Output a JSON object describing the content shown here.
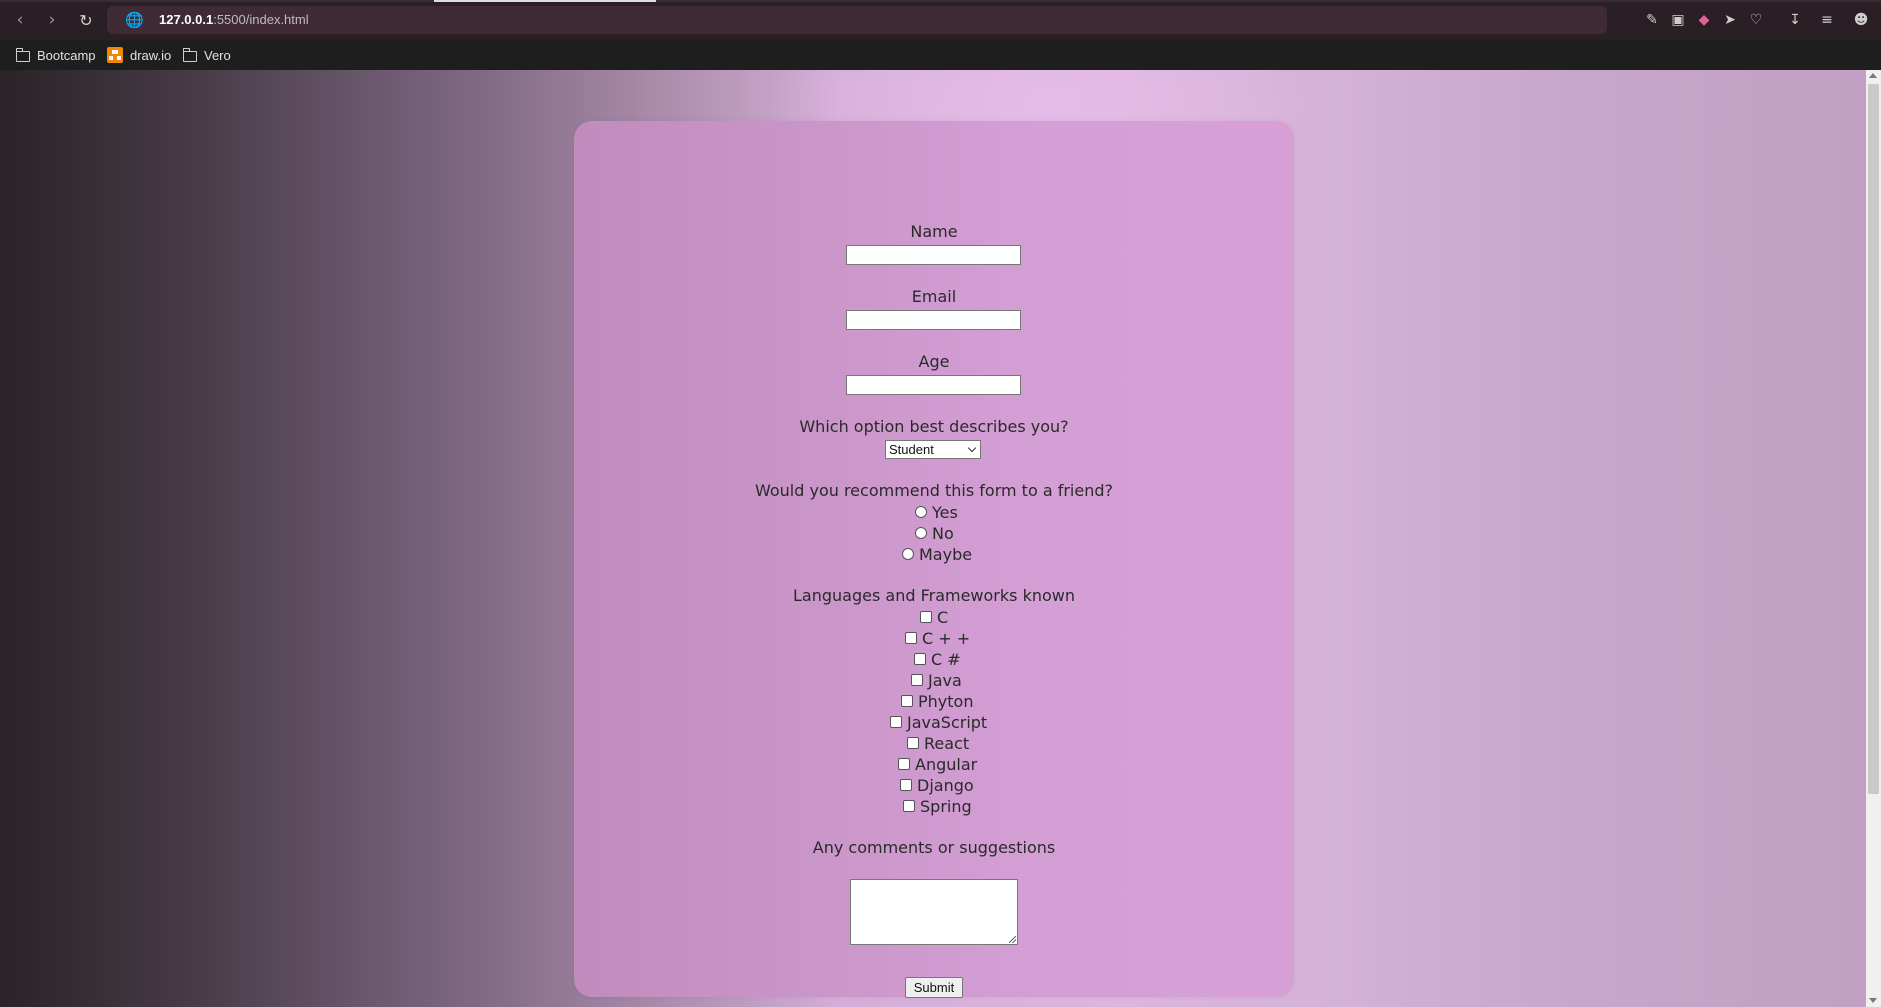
{
  "browser": {
    "url_host": "127.0.0.1",
    "url_rest": ":5500/index.html",
    "bookmarks": [
      {
        "label": "Bootcamp",
        "icon": "folder-icon"
      },
      {
        "label": "draw.io",
        "icon": "drawio-icon"
      },
      {
        "label": "Vero",
        "icon": "folder-icon"
      }
    ]
  },
  "form": {
    "name_label": "Name",
    "email_label": "Email",
    "age_label": "Age",
    "role_question": "Which option best describes you?",
    "role_selected": "Student",
    "recommend_question": "Would you recommend this form to a friend?",
    "recommend_options": [
      "Yes",
      "No",
      "Maybe"
    ],
    "languages_label": "Languages and Frameworks known",
    "languages": [
      "C",
      "C + +",
      "C #",
      "Java",
      "Phyton",
      "JavaScript",
      "React",
      "Angular",
      "Django",
      "Spring"
    ],
    "comments_label": "Any comments or suggestions",
    "submit_label": "Submit"
  }
}
